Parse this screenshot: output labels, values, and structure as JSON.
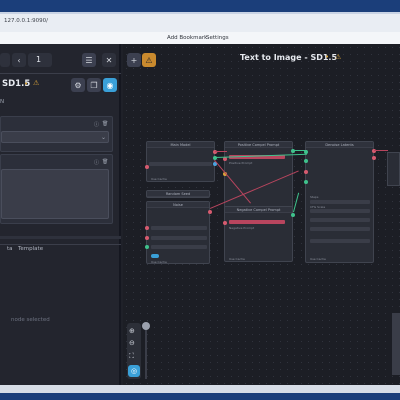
{
  "browser": {
    "url": "127.0.0.1:9090/",
    "bookmarks": {
      "add_bookmark": "Add Bookmark",
      "settings": "Settings"
    }
  },
  "left_panel": {
    "counter_value": "1",
    "workflow_title": "SD1.5",
    "workflow_dot": "•",
    "warning_icon": "⚠",
    "section_label": "N",
    "tabs": {
      "tab_a": "ta",
      "tab_b": "Template"
    },
    "empty_hint": "node selected"
  },
  "canvas": {
    "title": "Text to Image - SD1.5",
    "title_dot": "•",
    "warning_icon": "⚠",
    "toolbar": {
      "add_label": "+",
      "warn_label": "⚠"
    },
    "nodes": [
      {
        "id": "main-model",
        "title": "Main Model"
      },
      {
        "id": "positive",
        "title": "Positive Compel Prompt"
      },
      {
        "id": "denoise",
        "title": "Denoise Latents"
      },
      {
        "id": "random-seed",
        "title": "Random Seed"
      },
      {
        "id": "noise",
        "title": "Noise"
      },
      {
        "id": "negative",
        "title": "Negative Compel Prompt"
      }
    ],
    "node_labels": {
      "positive_value": "Positive Prompt",
      "negative_value": "Negative Prompt",
      "use_cache": "Use Cache",
      "value_20": "20",
      "value_7": "7.5",
      "value_0": "0",
      "value_1": "1",
      "scheduler": "euler",
      "steps": "Steps",
      "cfg": "CFG Scale"
    }
  },
  "colors": {
    "accent": "#3aa0d8",
    "warn": "#d9a33a",
    "wire": "#b8455e"
  }
}
